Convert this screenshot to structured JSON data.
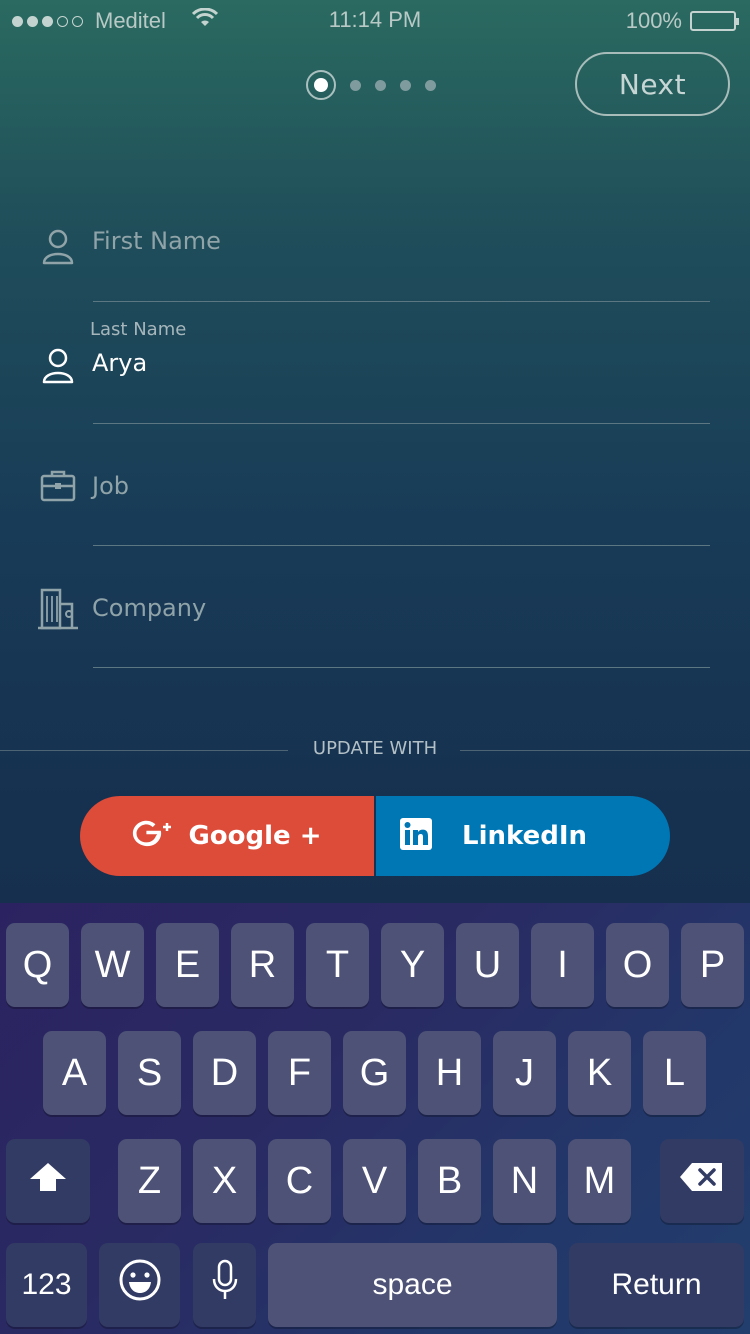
{
  "status_bar": {
    "carrier": "Meditel",
    "time": "11:14 PM",
    "battery": "100%",
    "signal_bars_filled": 3,
    "signal_bars_total": 5
  },
  "pager": {
    "current_page": 1,
    "total_pages": 5
  },
  "next_label": "Next",
  "form": {
    "first_name": {
      "placeholder": "First Name",
      "icon": "user-icon"
    },
    "last_name": {
      "label": "Last Name",
      "value": "Arya",
      "icon": "user-icon"
    },
    "job": {
      "placeholder": "Job",
      "icon": "briefcase-icon"
    },
    "company": {
      "placeholder": "Company",
      "icon": "building-icon"
    }
  },
  "update_with": "UPDATE WITH",
  "social": {
    "google_label": "Google +",
    "linkedin_label": "LinkedIn",
    "google_color": "#dd4b39",
    "linkedin_color": "#0077b5"
  },
  "keyboard": {
    "row1": [
      "Q",
      "W",
      "E",
      "R",
      "T",
      "Y",
      "U",
      "I",
      "O",
      "P"
    ],
    "row2": [
      "A",
      "S",
      "D",
      "F",
      "G",
      "H",
      "J",
      "K",
      "L"
    ],
    "row3": [
      "Z",
      "X",
      "C",
      "V",
      "B",
      "N",
      "M"
    ],
    "numbers_label": "123",
    "space_label": "space",
    "return_label": "Return"
  }
}
